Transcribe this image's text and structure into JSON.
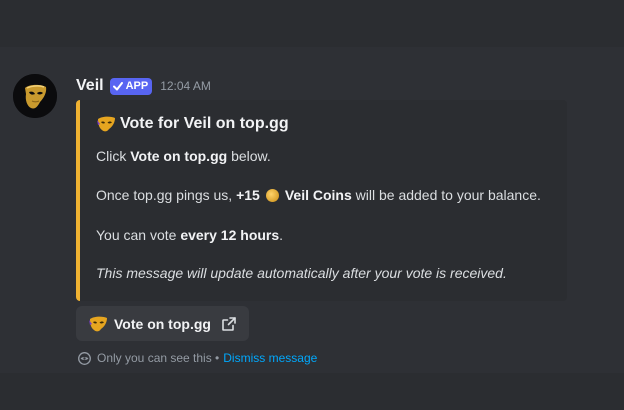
{
  "message": {
    "author": "Veil",
    "app_tag": "APP",
    "timestamp": "12:04 AM",
    "avatar_icon": "golden-mask-icon"
  },
  "embed": {
    "accent_color": "#f0b232",
    "title": "Vote for Veil on top.gg",
    "line1_prefix": "Click ",
    "line1_bold": "Vote on top.gg",
    "line1_suffix": " below.",
    "line2_prefix": "Once top.gg pings us, ",
    "line2_bold_amount": "+15",
    "line2_bold_currency": "Veil Coins",
    "line2_suffix": " will be added to your balance.",
    "line3_prefix": "You can vote ",
    "line3_bold": "every 12 hours",
    "line3_suffix": ".",
    "line4": "This message will update automatically after your vote is received."
  },
  "button": {
    "label": "Vote on top.gg",
    "icon": "external-link-icon"
  },
  "ephemeral": {
    "text": "Only you can see this •",
    "dismiss_label": "Dismiss message"
  }
}
